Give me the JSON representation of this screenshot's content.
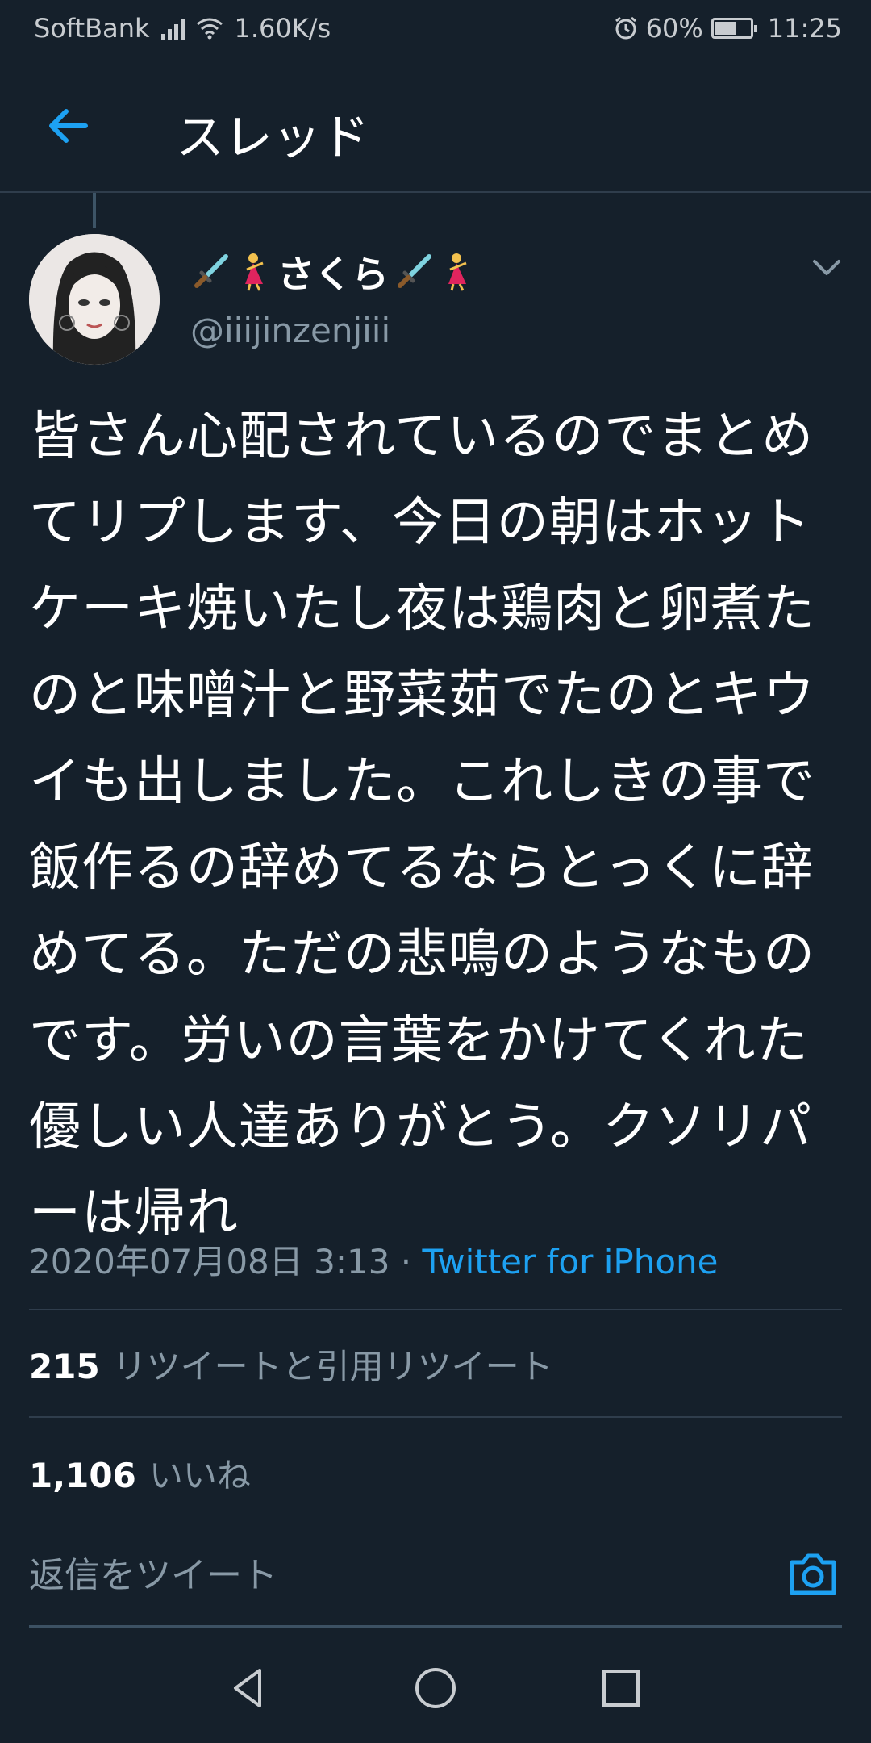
{
  "status": {
    "carrier": "SoftBank",
    "speed": "1.60K/s",
    "battery_pct": "60%",
    "battery_level": 0.6,
    "time": "11:25"
  },
  "header": {
    "title": "スレッド"
  },
  "tweet": {
    "name": "さくら",
    "handle": "@iiijinzenjiii",
    "text": "皆さん心配されているのでまとめ\nてリプします、今日の朝はホット\nケーキ焼いたし夜は鶏肉と卵煮た\nのと味噌汁と野菜茹でたのとキウ\nイも出しました。これしきの事で\n飯作るの辞めてるならとっくに辞\nめてる。ただの悲鳴のようなもの\nです。労いの言葉をかけてくれた\n優しい人達ありがとう。クソリパ\nーは帰れ",
    "date": "2020年07月08日 3:13",
    "separator": " · ",
    "source": "Twitter for iPhone"
  },
  "stats": {
    "retweets_count": "215",
    "retweets_label": "リツイートと引用リツイート",
    "likes_count": "1,106",
    "likes_label": "いいね"
  },
  "reply": {
    "placeholder": "返信をツイート"
  },
  "icons": {
    "back": "arrow-left-icon",
    "menu": "chevron-down-icon",
    "camera": "camera-icon",
    "nav_back": "triangle-back-icon",
    "nav_home": "circle-home-icon",
    "nav_recent": "square-recent-icon"
  },
  "colors": {
    "background": "#15202b",
    "accent": "#1da1f2",
    "muted": "#8899a6"
  }
}
